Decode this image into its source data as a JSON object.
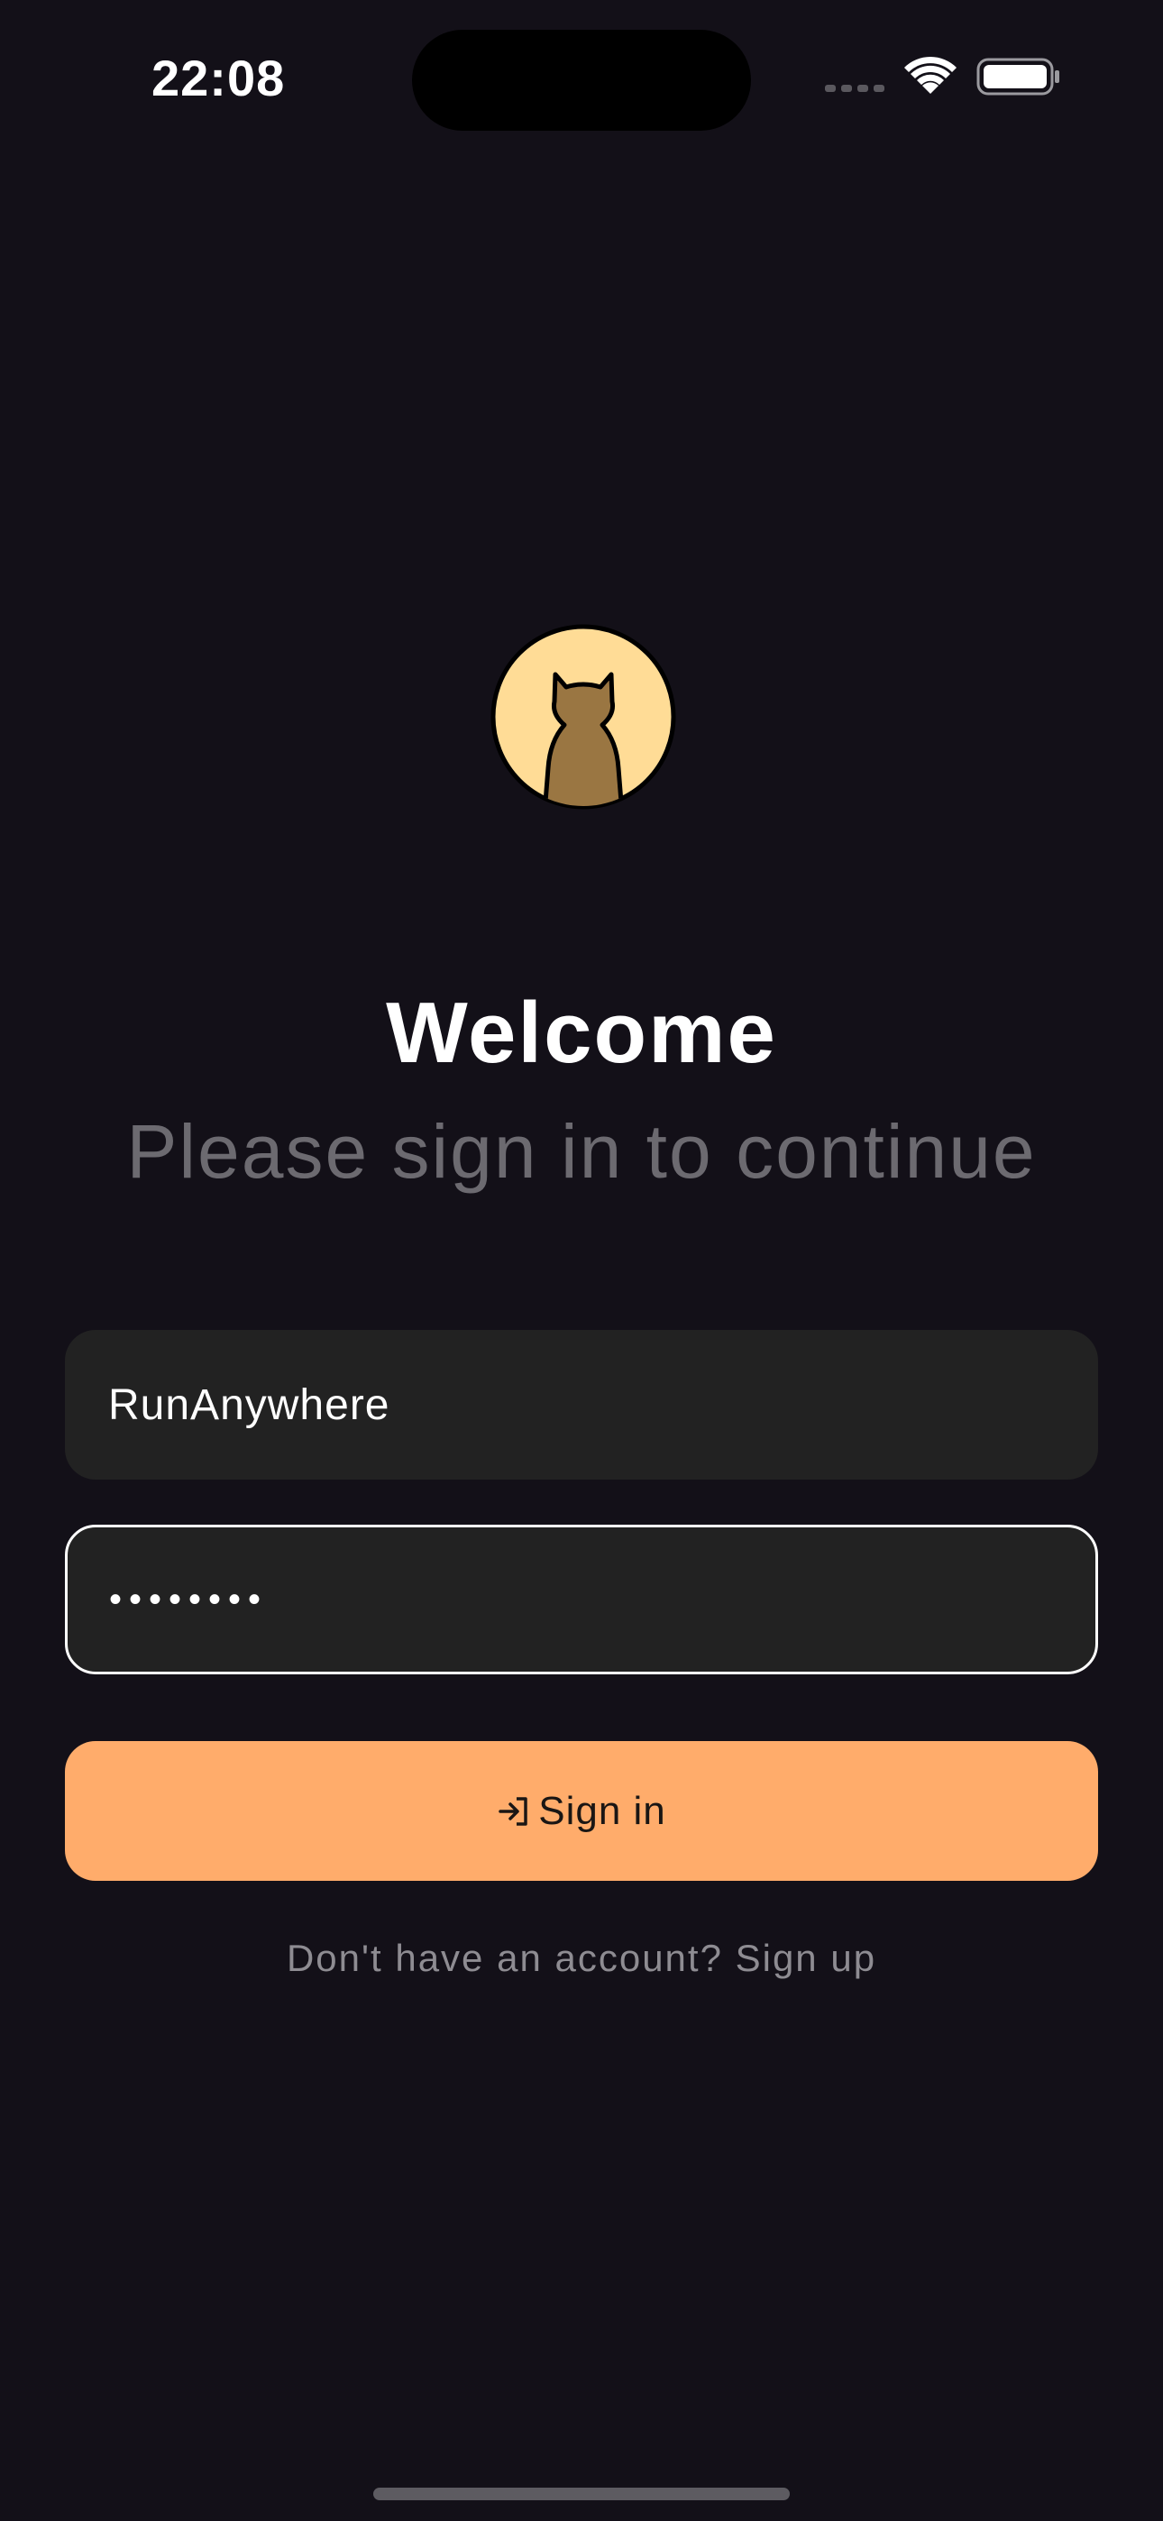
{
  "status_bar": {
    "time": "22:08",
    "icons": [
      "cellular-signal-icon",
      "wifi-icon",
      "battery-icon"
    ]
  },
  "logo": {
    "icon": "cat-silhouette-icon",
    "colors": {
      "background": "#FFDC96",
      "figure": "#9A7642",
      "outline": "#000000"
    }
  },
  "header": {
    "title": "Welcome",
    "subtitle": "Please sign in to continue"
  },
  "form": {
    "username_value": "RunAnywhere",
    "password_value": "••••••••",
    "submit_label": "Sign in",
    "submit_icon": "login-arrow-icon"
  },
  "footer": {
    "signup_prompt": "Don't have an account? Sign up"
  },
  "colors": {
    "background": "#131018",
    "field": "#222222",
    "accent": "#FFAC6B",
    "muted_text": "#6C6A70"
  }
}
